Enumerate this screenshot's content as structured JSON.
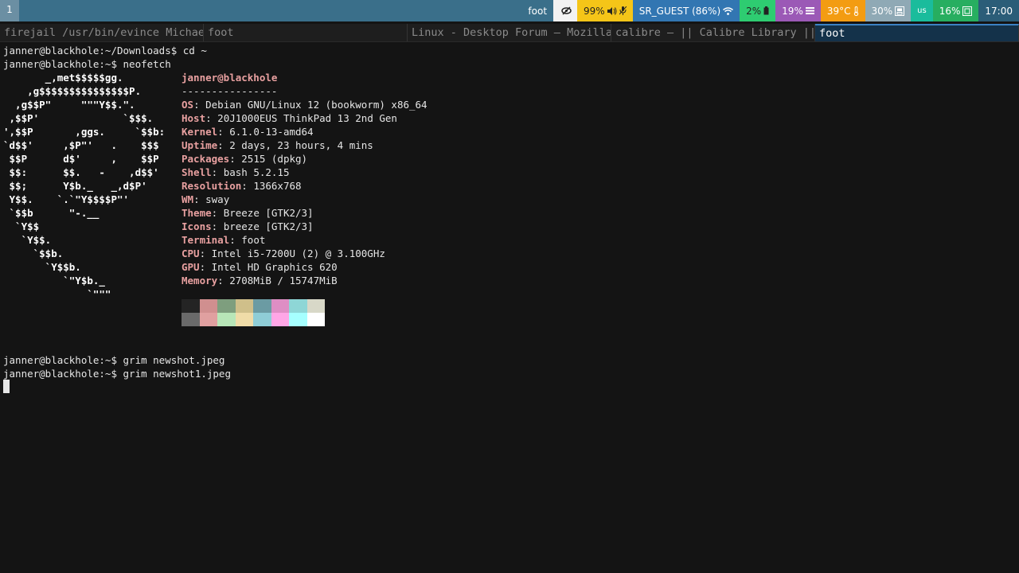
{
  "statusbar": {
    "workspace": "1",
    "focused_title": "foot",
    "volume": "99%",
    "network": "SR_GUEST (86%)",
    "battery": "2%",
    "memory": "19%",
    "temperature": "39°C",
    "disk": "30%",
    "language": "us",
    "cpu": "16%",
    "clock": "17:00"
  },
  "tabs": [
    {
      "label": "firejail /usr/bin/evince Michael",
      "active": false
    },
    {
      "label": "foot",
      "active": false
    },
    {
      "label": "Linux - Desktop Forum — Mozilla F",
      "active": false
    },
    {
      "label": "calibre — || Calibre Library ||",
      "active": false
    },
    {
      "label": "foot",
      "active": true
    }
  ],
  "terminal": {
    "lines_top": [
      "janner@blackhole:~/Downloads$ cd ~",
      "janner@blackhole:~$ neofetch"
    ],
    "ascii": [
      "       _,met$$$$$gg.",
      "    ,g$$$$$$$$$$$$$$$P.",
      "  ,g$$P\"     \"\"\"Y$$.\".",
      " ,$$P'              `$$$.",
      "',$$P       ,ggs.     `$$b:",
      "`d$$'     ,$P\"'   .    $$$",
      " $$P      d$'     ,    $$P",
      " $$:      $$.   -    ,d$$'",
      " $$;      Y$b._   _,d$P'",
      " Y$$.    `.`\"Y$$$$P\"'",
      " `$$b      \"-.__",
      "  `Y$$",
      "   `Y$$.",
      "     `$$b.",
      "       `Y$$b.",
      "          `\"Y$b._",
      "              `\"\"\""
    ],
    "userhost": "janner@blackhole",
    "separator": "----------------",
    "info": [
      {
        "key": "OS",
        "value": "Debian GNU/Linux 12 (bookworm) x86_64"
      },
      {
        "key": "Host",
        "value": "20J1000EUS ThinkPad 13 2nd Gen"
      },
      {
        "key": "Kernel",
        "value": "6.1.0-13-amd64"
      },
      {
        "key": "Uptime",
        "value": "2 days, 23 hours, 4 mins"
      },
      {
        "key": "Packages",
        "value": "2515 (dpkg)"
      },
      {
        "key": "Shell",
        "value": "bash 5.2.15"
      },
      {
        "key": "Resolution",
        "value": "1366x768"
      },
      {
        "key": "WM",
        "value": "sway"
      },
      {
        "key": "Theme",
        "value": "Breeze [GTK2/3]"
      },
      {
        "key": "Icons",
        "value": "breeze [GTK2/3]"
      },
      {
        "key": "Terminal",
        "value": "foot"
      },
      {
        "key": "CPU",
        "value": "Intel i5-7200U (2) @ 3.100GHz"
      },
      {
        "key": "GPU",
        "value": "Intel HD Graphics 620"
      },
      {
        "key": "Memory",
        "value": "2708MiB / 15747MiB"
      }
    ],
    "palette": [
      "#242424",
      "#d08f8f",
      "#7e9e7e",
      "#cfbf8a",
      "#6b9ba3",
      "#de8ec4",
      "#8ed6d6",
      "#d8d8c8",
      "#6a6a6a",
      "#e0a0a0",
      "#b8e6b8",
      "#f0dca8",
      "#8fcdd6",
      "#ffa6e6",
      "#a6ffff",
      "#ffffff"
    ],
    "lines_bottom": [
      "janner@blackhole:~$ grim newshot.jpeg",
      "janner@blackhole:~$ grim newshot1.jpeg"
    ]
  }
}
